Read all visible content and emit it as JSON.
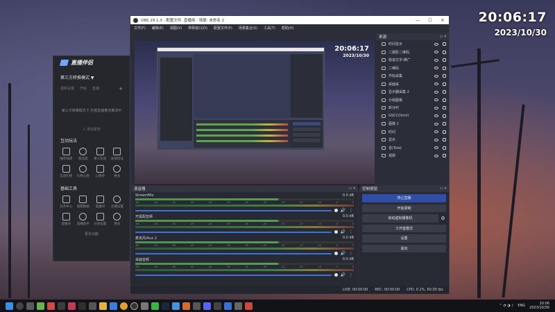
{
  "desktop_clock": {
    "time": "20:06:17",
    "date": "2023/10/30"
  },
  "helper_app": {
    "title": "直播伴侣",
    "mode": "第三方转推模式 ▼",
    "tabs": [
      "视频设置",
      "开始",
      "直播"
    ],
    "plus": "+",
    "empty_text": "第三方转推模式下 外部直播推流推流中",
    "add_label": "+ 添加素材",
    "section_interaction": "互动玩法",
    "interaction_items": [
      {
        "label": "抽奖福袋",
        "icon": "gift-icon"
      },
      {
        "label": "粉丝团",
        "icon": "group-icon"
      },
      {
        "label": "来人欢迎",
        "icon": "wave-icon"
      },
      {
        "label": "连线玩法",
        "icon": "link-icon"
      },
      {
        "label": "互动礼物",
        "icon": "present-icon"
      },
      {
        "label": "礼物心愿",
        "icon": "heart-icon"
      },
      {
        "label": "心愿单",
        "icon": "star-icon"
      },
      {
        "label": "更多",
        "icon": "more-icon"
      }
    ],
    "section_tools": "基础工具",
    "tool_items": [
      {
        "label": "任务中心",
        "icon": "task-icon"
      },
      {
        "label": "观看数据",
        "icon": "chart-icon"
      },
      {
        "label": "直播间",
        "icon": "room-icon"
      },
      {
        "label": "主播设置",
        "icon": "settings-icon"
      },
      {
        "label": "直播间",
        "icon": "home-icon"
      },
      {
        "label": "直播助手",
        "icon": "assistant-icon"
      },
      {
        "label": "分发设置",
        "icon": "share-icon"
      },
      {
        "label": "更多",
        "icon": "more-icon"
      }
    ],
    "more_label": "更多功能"
  },
  "obs": {
    "title": "OBS 29.1.3 - 配置文件: 直播用 - 场景: 未命名 2",
    "window_controls": [
      "—",
      "☐",
      "✕"
    ],
    "menu": [
      "文件(F)",
      "编辑(E)",
      "视图(V)",
      "停靠窗口(D)",
      "配置文件(P)",
      "场景集合(S)",
      "工具(T)",
      "帮助(H)"
    ],
    "preview_clock": {
      "time": "20:06:17",
      "date": "2023/10/30"
    },
    "sources_title": "来源",
    "sources": [
      {
        "name": "时间显示",
        "icon": "clock-icon"
      },
      {
        "name": "二摄影二维码",
        "icon": "image-icon"
      },
      {
        "name": "除道文字-推广",
        "icon": "text-icon"
      },
      {
        "name": "二维码",
        "icon": "image-icon"
      },
      {
        "name": "开始采集",
        "icon": "capture-icon"
      },
      {
        "name": "桌面采",
        "icon": "monitor-icon"
      },
      {
        "name": "显示器采集 2",
        "icon": "monitor-icon"
      },
      {
        "name": "分组图像",
        "icon": "folder-icon"
      },
      {
        "name": "新分时",
        "icon": "image-icon"
      },
      {
        "name": "GSCC(html)",
        "icon": "browser-icon"
      },
      {
        "name": "图像 2",
        "icon": "image-icon"
      },
      {
        "name": "时间",
        "icon": "image-icon"
      },
      {
        "name": "显示",
        "icon": "image-icon"
      },
      {
        "name": "音(Tstd)",
        "icon": "folder-icon"
      },
      {
        "name": "视频",
        "icon": "folder-icon"
      }
    ],
    "sources_toolbar": [
      "+",
      "🗑",
      "⚙",
      "▲",
      "▼"
    ],
    "mixer_title": "混音器",
    "mixer_scale": [
      "-60",
      "-55",
      "-50",
      "-45",
      "-40",
      "-35",
      "-30",
      "-25",
      "-20",
      "-15",
      "-10",
      "-5",
      "0"
    ],
    "tracks": [
      {
        "name": "StreamMix",
        "db": "0.0 dB"
      },
      {
        "name": "开黑配音频",
        "db": "0.0 dB"
      },
      {
        "name": "麦克风/Aux 2",
        "db": "0.0 dB"
      },
      {
        "name": "桌面音频",
        "db": "0.0 dB"
      }
    ],
    "controls_title": "控制按钮",
    "controls": {
      "stop_stream": "停止直播",
      "start_record": "开始录制",
      "virtual_cam": "启动虚拟摄像机",
      "studio_mode": "工作室模式",
      "settings": "设置",
      "exit": "退出"
    },
    "status": {
      "live": "LIVE: 00:00:00",
      "rec": "REC: 00:00:00",
      "cpu": "CPU: 0.2%, 60.00 fps"
    }
  },
  "taskbar": {
    "tray_lang": "ENG",
    "time": "20:06",
    "date": "2023/10/30"
  },
  "colors": {
    "accent_blue": "#2f4ea6",
    "obs_bg": "#2b2e38",
    "meter_green": "#58b84e"
  }
}
